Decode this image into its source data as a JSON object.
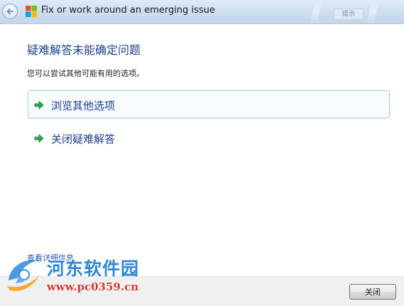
{
  "window": {
    "title": "Fix or work around an emerging issue",
    "title_hint": "提示"
  },
  "content": {
    "heading": "疑难解答未能确定问题",
    "description": "您可以尝试其他可能有用的选项。",
    "options": [
      {
        "label": "浏览其他选项",
        "icon": "green-arrow-icon",
        "focused": true
      },
      {
        "label": "关闭疑难解答",
        "icon": "green-arrow-icon",
        "focused": false
      }
    ],
    "details_link": "查看详细信息"
  },
  "footer": {
    "close_label": "关闭"
  },
  "watermark": {
    "name": "河东软件园",
    "url": "www.pc0359.cn"
  },
  "colors": {
    "heading": "#1a3f8c",
    "link": "#1f5ab4",
    "arrow": "#2ea44f",
    "focus_border": "#9bd1e6",
    "watermark_name": "#2f86d6",
    "watermark_url": "#d2382c"
  }
}
